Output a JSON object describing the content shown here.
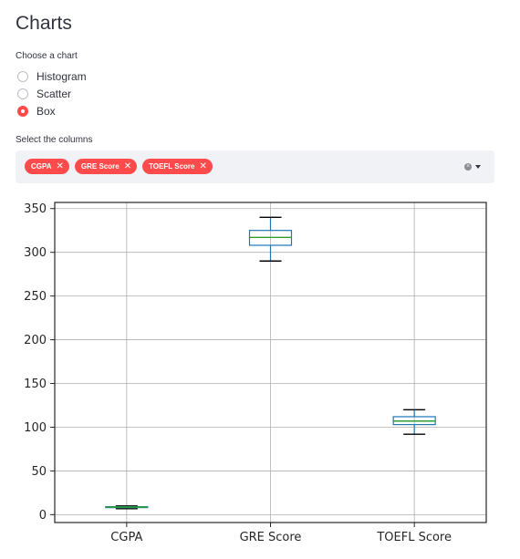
{
  "page": {
    "title": "Charts",
    "chart_chooser_label": "Choose a chart",
    "chart_options": [
      {
        "label": "Histogram",
        "selected": false
      },
      {
        "label": "Scatter",
        "selected": false
      },
      {
        "label": "Box",
        "selected": true
      }
    ],
    "columns_label": "Select the columns",
    "selected_columns": [
      "CGPA",
      "GRE Score",
      "TOEFL Score"
    ],
    "tag_close_glyph": "✕",
    "clear_glyph": "×",
    "accent_color": "#ff4b4b"
  },
  "chart_data": {
    "type": "box",
    "categories": [
      "CGPA",
      "GRE Score",
      "TOEFL Score"
    ],
    "boxes": [
      {
        "name": "CGPA",
        "min": 6.8,
        "q1": 8.1,
        "median": 8.6,
        "q3": 9.1,
        "max": 9.9
      },
      {
        "name": "GRE Score",
        "min": 290,
        "q1": 308,
        "median": 317,
        "q3": 325,
        "max": 340
      },
      {
        "name": "TOEFL Score",
        "min": 92,
        "q1": 103,
        "median": 107,
        "q3": 112,
        "max": 120
      }
    ],
    "yticks": [
      0,
      50,
      100,
      150,
      200,
      250,
      300,
      350
    ],
    "ylim": [
      -9,
      357
    ],
    "grid": true,
    "box_color": "#1f77b4",
    "median_color": "#2ca02c",
    "whisker_color": "#000000"
  }
}
